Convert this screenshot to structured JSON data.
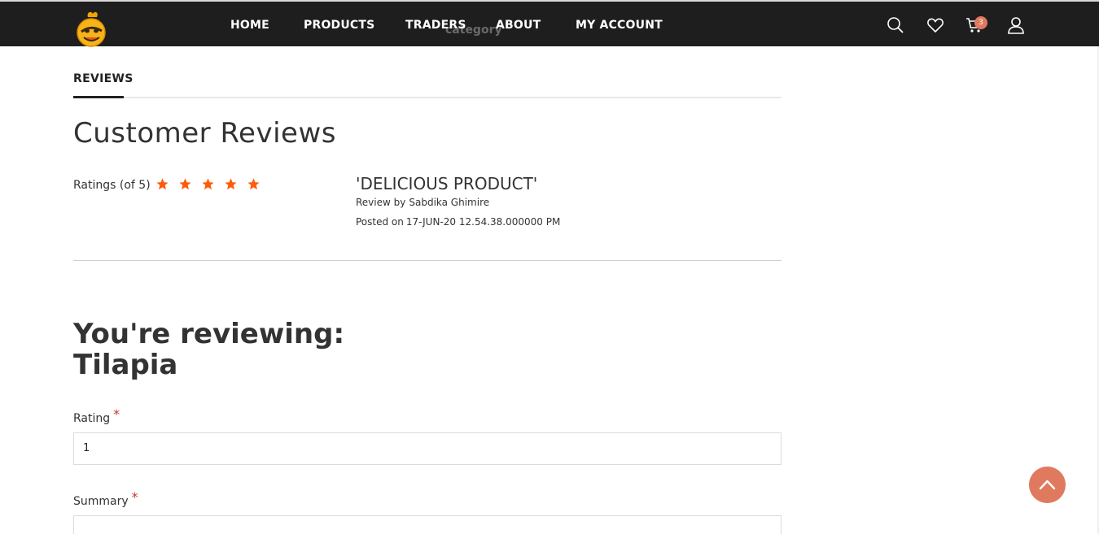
{
  "header": {
    "nav": [
      "HOME",
      "PRODUCTS",
      "TRADERS",
      "ABOUT",
      "MY ACCOUNT"
    ],
    "ghost_text": "category",
    "cart_count": "3",
    "icons": [
      "search-icon",
      "heart-icon",
      "cart-icon",
      "user-icon"
    ]
  },
  "tabs": {
    "active": "REVIEWS"
  },
  "reviews": {
    "title": "Customer Reviews",
    "ratings_label": "Ratings (of 5)",
    "stars": 5,
    "star_color": "#ff5a0a",
    "items": [
      {
        "title": "'DELICIOUS PRODUCT'",
        "by_label": "Review by",
        "author": "Sabdika Ghimire",
        "posted_label": "Posted on",
        "date": "17-JUN-20 12.54.38.000000 PM"
      }
    ]
  },
  "form": {
    "heading_line1": "You're reviewing:",
    "heading_line2": "Tilapia",
    "rating_label": "Rating",
    "rating_value": "1",
    "summary_label": "Summary",
    "required_mark": "*"
  },
  "colors": {
    "accent": "#e07a5f",
    "topbar": "#1e1e1e"
  }
}
